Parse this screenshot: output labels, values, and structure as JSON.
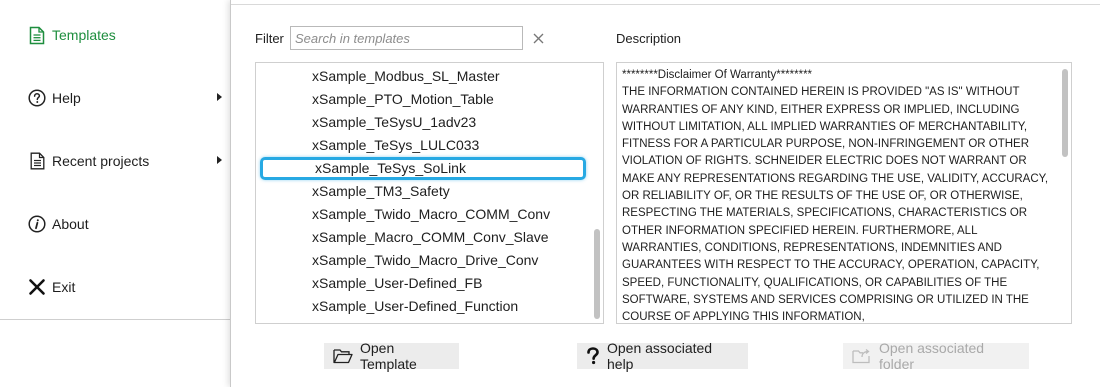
{
  "menu": {
    "items": [
      {
        "label": "Templates",
        "icon": "template-document-icon",
        "active": true
      },
      {
        "label": "Help",
        "icon": "question-circle-icon",
        "submenu": true
      },
      {
        "label": "Recent projects",
        "icon": "document-icon",
        "submenu": true
      },
      {
        "label": "About",
        "icon": "info-circle-icon"
      },
      {
        "label": "Exit",
        "icon": "close-x-icon"
      }
    ]
  },
  "filter": {
    "label": "Filter",
    "placeholder": "Search in templates",
    "value": ""
  },
  "description": {
    "label": "Description",
    "text": "********Disclaimer Of Warranty********\nTHE INFORMATION CONTAINED HEREIN IS PROVIDED \"AS IS\" WITHOUT WARRANTIES OF ANY KIND, EITHER EXPRESS OR IMPLIED, INCLUDING WITHOUT LIMITATION, ALL IMPLIED WARRANTIES OF MERCHANTABILITY, FITNESS FOR A PARTICULAR PURPOSE, NON-INFRINGEMENT OR OTHER VIOLATION OF RIGHTS. SCHNEIDER ELECTRIC DOES NOT WARRANT OR MAKE ANY REPRESENTATIONS REGARDING THE USE, VALIDITY, ACCURACY, OR RELIABILITY OF, OR THE RESULTS OF THE USE OF, OR OTHERWISE, RESPECTING THE MATERIALS, SPECIFICATIONS, CHARACTERISTICS OR OTHER INFORMATION SPECIFIED HEREIN. FURTHERMORE, ALL WARRANTIES, CONDITIONS, REPRESENTATIONS, INDEMNITIES AND GUARANTEES WITH RESPECT TO THE ACCURACY, OPERATION, CAPACITY, SPEED, FUNCTIONALITY, QUALIFICATIONS, OR CAPABILITIES OF THE SOFTWARE, SYSTEMS AND SERVICES COMPRISING OR UTILIZED IN THE COURSE OF APPLYING THIS INFORMATION,"
  },
  "templates": {
    "items": [
      "xSample_Modbus_SL_Master",
      "xSample_PTO_Motion_Table",
      "xSample_TeSysU_1adv23",
      "xSample_TeSys_LULC033",
      "xSample_TeSys_SoLink",
      "xSample_TM3_Safety",
      "xSample_Twido_Macro_COMM_Conv",
      "xSample_Macro_COMM_Conv_Slave",
      "xSample_Twido_Macro_Drive_Conv",
      "xSample_User-Defined_FB",
      "xSample_User-Defined_Function"
    ],
    "selected_index": 4
  },
  "buttons": {
    "open_template": "Open Template",
    "open_help": "Open associated help",
    "open_folder": "Open associated folder",
    "open_folder_enabled": false
  },
  "colors": {
    "active_menu": "#1e8e3e",
    "selection_border": "#27a9e3",
    "button_bg": "#ececec",
    "disabled_text": "#a9a9a9"
  }
}
